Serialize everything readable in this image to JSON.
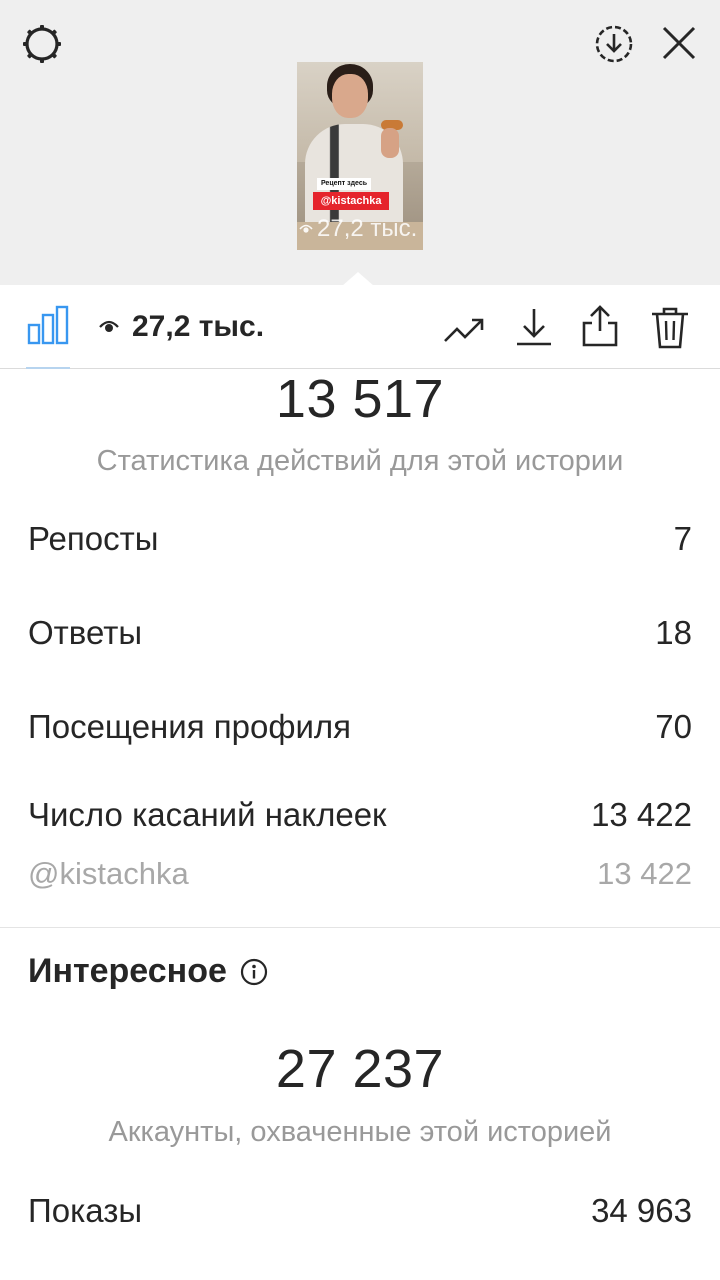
{
  "story_preview": {
    "caption_top": "Рецепт здесь",
    "mention_sticker": "@kistachka",
    "views_overlay": "27,2 тыс."
  },
  "toolbar": {
    "views": "27,2 тыс."
  },
  "interactions": {
    "total": "13 517",
    "caption": "Статистика действий для этой истории",
    "rows": [
      {
        "label": "Репосты",
        "value": "7"
      },
      {
        "label": "Ответы",
        "value": "18"
      },
      {
        "label": "Посещения профиля",
        "value": "70"
      },
      {
        "label": "Число касаний наклеек",
        "value": "13 422"
      }
    ],
    "sticker_row": {
      "label": "@kistachka",
      "value": "13 422"
    }
  },
  "discovery": {
    "title": "Интересное",
    "reach": "27 237",
    "reach_caption": "Аккаунты, охваченные этой историей",
    "impressions": {
      "label": "Показы",
      "value": "34 963"
    }
  },
  "colors": {
    "accent": "#3897f0",
    "text": "#262626",
    "muted": "#999999",
    "sticker_red": "#e5242c"
  }
}
